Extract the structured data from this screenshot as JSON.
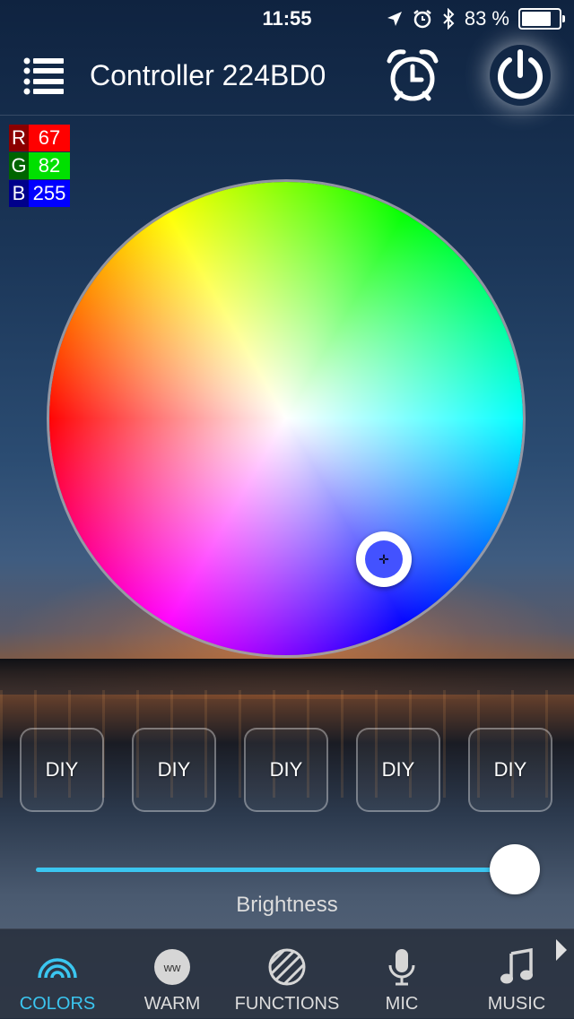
{
  "status_bar": {
    "time": "11:55",
    "battery_text": "83 %",
    "battery_level": 0.83
  },
  "header": {
    "title": "Controller 224BD0"
  },
  "rgb": {
    "r_label": "R",
    "r_value": "67",
    "g_label": "G",
    "g_value": "82",
    "b_label": "B",
    "b_value": "255",
    "r_color": "#ff0000",
    "g_color": "#00e000",
    "b_color": "#0000ff",
    "selected_color": "#4352ff"
  },
  "diy_buttons": [
    "DIY",
    "DIY",
    "DIY",
    "DIY",
    "DIY"
  ],
  "brightness": {
    "label": "Brightness",
    "level": 0.98
  },
  "tabs": [
    {
      "label": "COLORS",
      "icon": "rainbow-icon",
      "active": true
    },
    {
      "label": "WARM",
      "icon": "ww-icon",
      "active": false
    },
    {
      "label": "FUNCTIONS",
      "icon": "stripes-icon",
      "active": false
    },
    {
      "label": "MIC",
      "icon": "microphone-icon",
      "active": false
    },
    {
      "label": "MUSIC",
      "icon": "music-note-icon",
      "active": false
    }
  ],
  "colors": {
    "accent": "#3bc6f0"
  }
}
